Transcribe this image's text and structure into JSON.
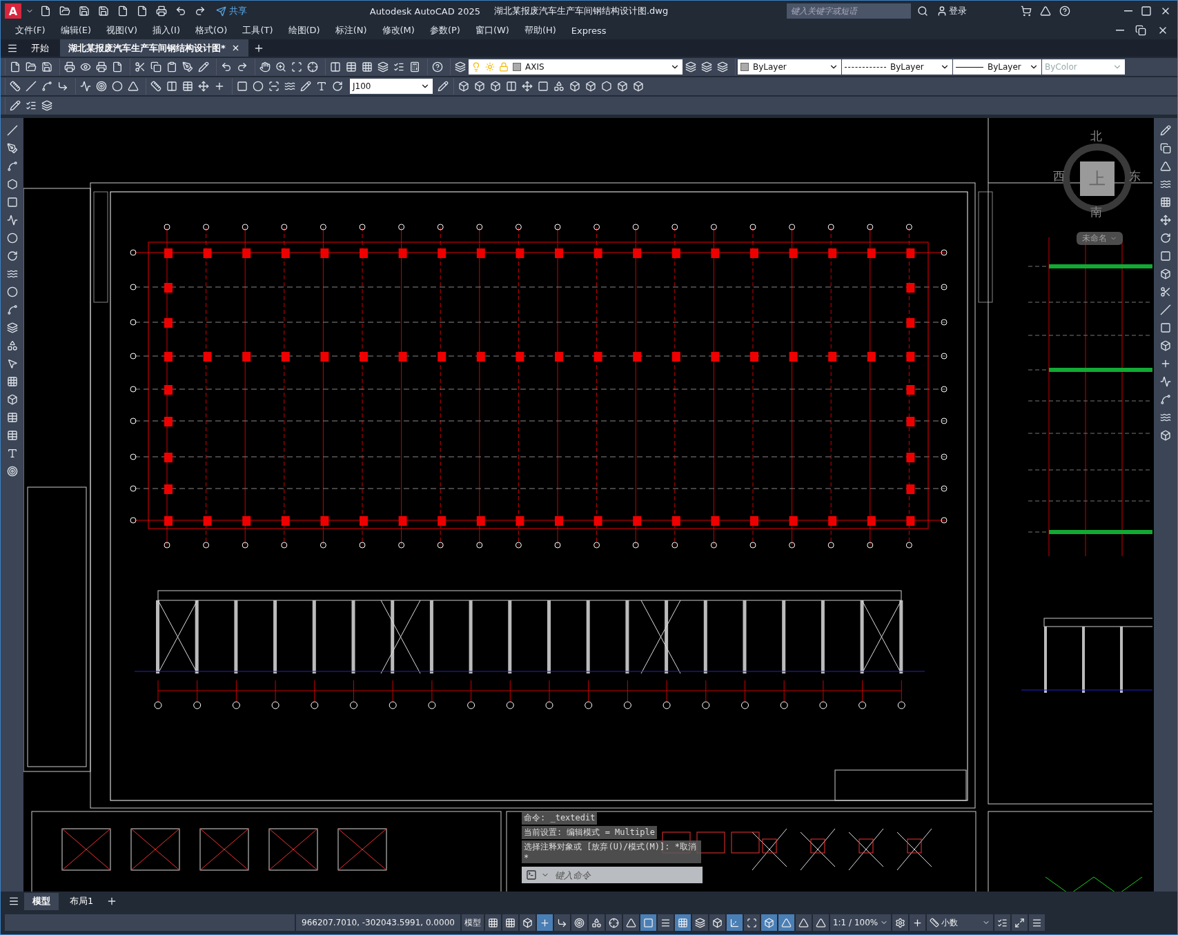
{
  "title_bar": {
    "app_letter": "A",
    "share": "共享",
    "title": "Autodesk AutoCAD 2025",
    "file": "湖北某报废汽车生产车间钢结构设计图.dwg",
    "search": {
      "placeholder": "键入关键字或短语"
    },
    "sign_in": "登录"
  },
  "menu": [
    "文件(F)",
    "编辑(E)",
    "视图(V)",
    "插入(I)",
    "格式(O)",
    "工具(T)",
    "绘图(D)",
    "标注(N)",
    "修改(M)",
    "参数(P)",
    "窗口(W)",
    "帮助(H)",
    "Express"
  ],
  "doc_tabs": [
    {
      "label": "开始",
      "selected": false
    },
    {
      "label": "湖北某报废汽车生产车间钢结构设计图*",
      "selected": true
    }
  ],
  "properties": {
    "layer": "AXIS",
    "color_setting": "ByLayer",
    "linetype": "ByLayer",
    "lineweight": "ByLayer",
    "plot_style": {
      "value": "ByColor",
      "disabled": true
    }
  },
  "dim_style": "J100",
  "viewcube": {
    "north": "北",
    "west": "西",
    "top": "上",
    "east": "东",
    "south": "南",
    "ucs": "未命名"
  },
  "command_line": {
    "history": [
      "命令: _textedit",
      "当前设置: 编辑模式 = Multiple",
      "选择注释对象或 [放弃(U)/模式(M)]: *取消*"
    ],
    "placeholder": "键入命令"
  },
  "layout_tabs": [
    {
      "label": "模型",
      "selected": true
    },
    {
      "label": "布局1",
      "selected": false
    }
  ],
  "status_bar": {
    "coordinates": "966207.7010, -302043.5991, 0.0000",
    "space": "模型",
    "scale": "1:1 / 100%",
    "units": "小数",
    "toggles": [
      {
        "kind": "grid",
        "on": false
      },
      {
        "kind": "snap",
        "on": false
      },
      {
        "kind": "infer",
        "on": false
      },
      {
        "kind": "dynamic",
        "on": true
      },
      {
        "kind": "ortho",
        "on": false
      },
      {
        "kind": "polar",
        "on": false
      },
      {
        "kind": "iso",
        "on": false
      },
      {
        "kind": "tracking",
        "on": false
      },
      {
        "kind": "angle",
        "on": false
      },
      {
        "kind": "osnap",
        "on": true
      },
      {
        "kind": "lineweight",
        "on": false
      },
      {
        "kind": "transparency",
        "on": true
      },
      {
        "kind": "cycling",
        "on": false
      },
      {
        "kind": "osnap3d",
        "on": false
      },
      {
        "kind": "ucs",
        "on": true
      },
      {
        "kind": "gizmo",
        "on": false
      },
      {
        "kind": "gizmo3d",
        "on": true
      },
      {
        "kind": "annovis",
        "on": true
      },
      {
        "kind": "autoscale",
        "on": false
      },
      {
        "kind": "annoscale",
        "on": false
      }
    ]
  }
}
